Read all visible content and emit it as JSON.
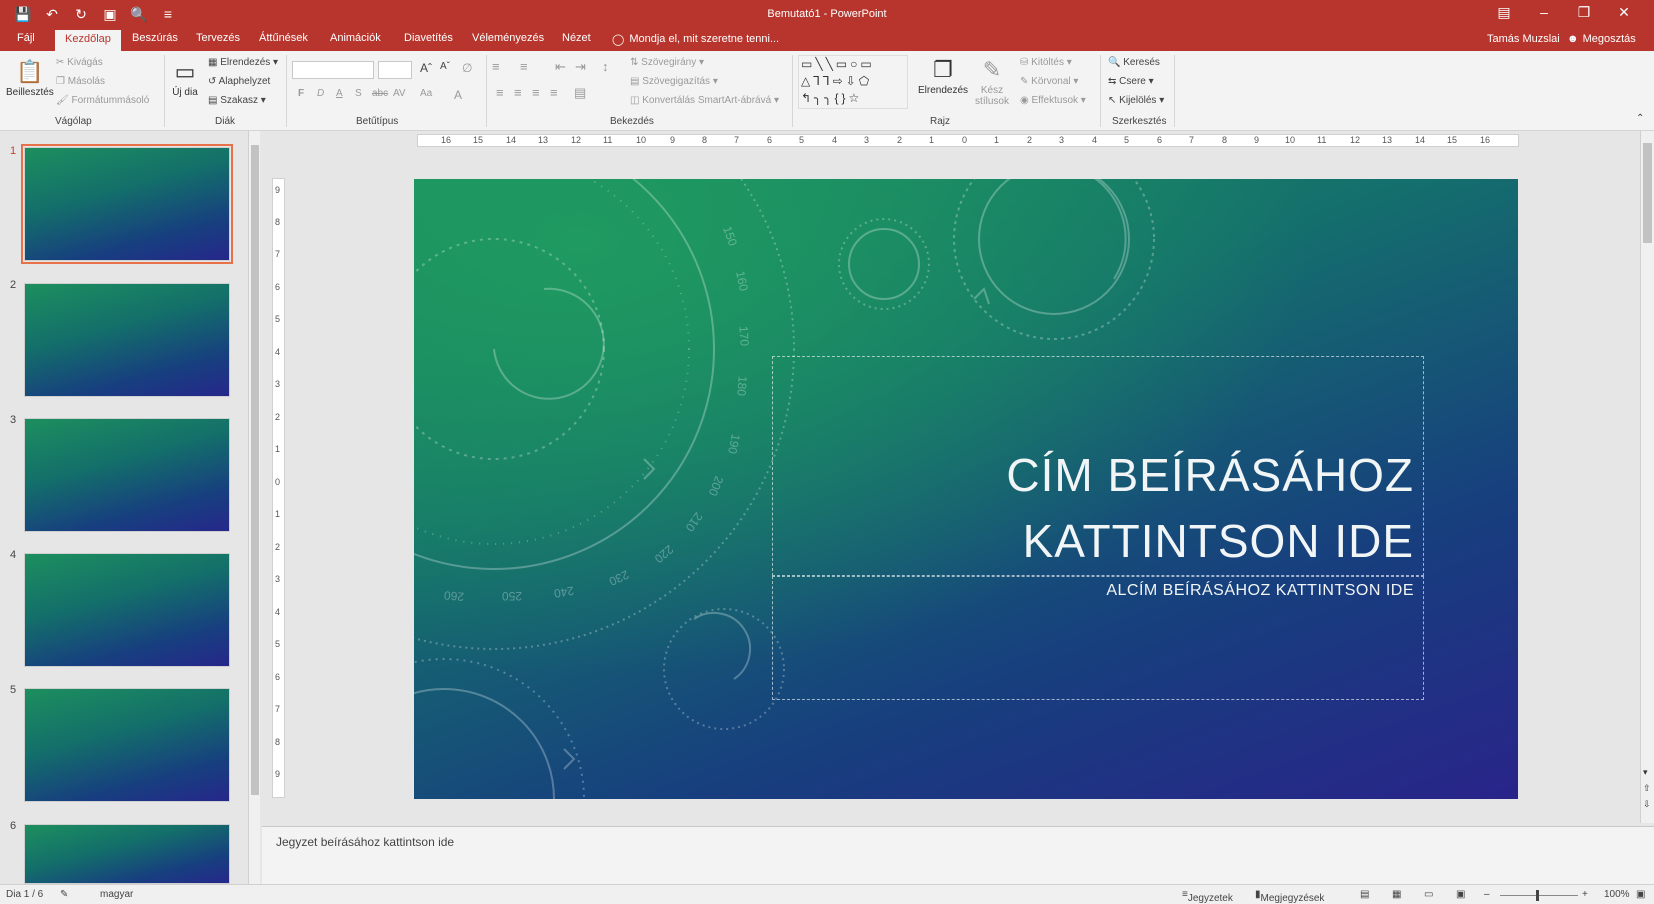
{
  "window": {
    "title": "Bemutató1 - PowerPoint",
    "controls": [
      "ribbon-display-icon",
      "minimize-icon",
      "restore-icon",
      "close-icon"
    ]
  },
  "qat": [
    "save-icon",
    "undo-icon",
    "redo-icon",
    "start-slideshow-icon",
    "print-preview-icon",
    "customize-qat-icon"
  ],
  "tabs": [
    {
      "label": "Fájl",
      "active": false
    },
    {
      "label": "Kezdőlap",
      "active": true
    },
    {
      "label": "Beszúrás",
      "active": false
    },
    {
      "label": "Tervezés",
      "active": false
    },
    {
      "label": "Áttűnések",
      "active": false
    },
    {
      "label": "Animációk",
      "active": false
    },
    {
      "label": "Diavetítés",
      "active": false
    },
    {
      "label": "Véleményezés",
      "active": false
    },
    {
      "label": "Nézet",
      "active": false
    }
  ],
  "tellme": "Mondja el, mit szeretne tenni...",
  "user": "Tamás Muzslai",
  "share": "Megosztás",
  "ribbon": {
    "clipboard": {
      "paste": "Beillesztés",
      "cut": "Kivágás",
      "copy": "Másolás",
      "format_painter": "Formátummásoló",
      "group": "Vágólap"
    },
    "slides": {
      "new_slide": "Új dia",
      "layout": "Elrendezés",
      "reset": "Alaphelyzet",
      "section": "Szakasz",
      "group": "Diák"
    },
    "font": {
      "group": "Betűtípus",
      "bold": "F",
      "italic": "D",
      "underline": "A",
      "shadow": "S",
      "strike": "abc",
      "spacing": "AV",
      "case": "Aa",
      "color": "A"
    },
    "paragraph": {
      "text_direction": "Szövegirány",
      "align_text": "Szövegigazítás",
      "convert_smartart": "Konvertálás SmartArt-ábrává",
      "group": "Bekezdés"
    },
    "drawing": {
      "arrange": "Elrendezés",
      "quick_styles": "Kész stílusok",
      "fill": "Kitöltés",
      "outline": "Körvonal",
      "effects": "Effektusok",
      "group": "Rajz"
    },
    "editing": {
      "find": "Keresés",
      "replace": "Csere",
      "select": "Kijelölés",
      "group": "Szerkesztés"
    }
  },
  "slides": [
    {
      "num": "1",
      "active": true
    },
    {
      "num": "2",
      "active": false
    },
    {
      "num": "3",
      "active": false
    },
    {
      "num": "4",
      "active": false
    },
    {
      "num": "5",
      "active": false
    },
    {
      "num": "6",
      "active": false
    }
  ],
  "ruler_h": [
    "16",
    "15",
    "14",
    "13",
    "12",
    "11",
    "10",
    "9",
    "8",
    "7",
    "6",
    "5",
    "4",
    "3",
    "2",
    "1",
    "0",
    "1",
    "2",
    "3",
    "4",
    "5",
    "6",
    "7",
    "8",
    "9",
    "10",
    "11",
    "12",
    "13",
    "14",
    "15",
    "16"
  ],
  "ruler_v": [
    "9",
    "8",
    "7",
    "6",
    "5",
    "4",
    "3",
    "2",
    "1",
    "0",
    "1",
    "2",
    "3",
    "4",
    "5",
    "6",
    "7",
    "8",
    "9"
  ],
  "slide": {
    "title_line1": "CÍM BEÍRÁSÁHOZ",
    "title_line2": "KATTINTSON IDE",
    "subtitle": "ALCÍM BEÍRÁSÁHOZ KATTINTSON IDE",
    "dial_numbers": [
      "150",
      "160",
      "170",
      "180",
      "190",
      "200",
      "210",
      "220",
      "230",
      "240",
      "250",
      "260"
    ]
  },
  "notes_placeholder": "Jegyzet beírásához kattintson ide",
  "status": {
    "slide_count": "Dia 1 / 6",
    "language": "magyar",
    "notes": "Jegyzetek",
    "comments": "Megjegyzések",
    "zoom": "100%"
  },
  "colors": {
    "accent": "#b7352d",
    "slide_green": "#1a8e60",
    "slide_blue": "#29248a"
  }
}
